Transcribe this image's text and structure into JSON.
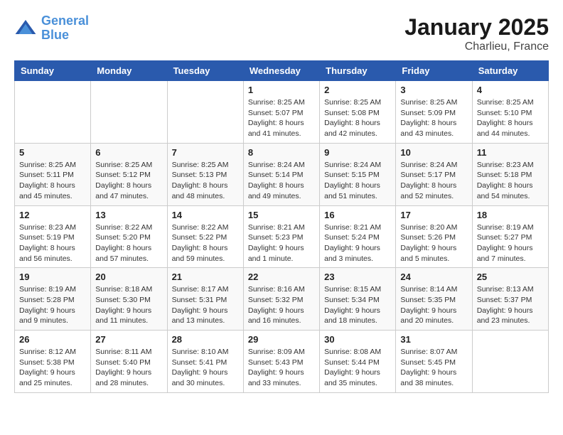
{
  "header": {
    "logo_line1": "General",
    "logo_line2": "Blue",
    "month": "January 2025",
    "location": "Charlieu, France"
  },
  "weekdays": [
    "Sunday",
    "Monday",
    "Tuesday",
    "Wednesday",
    "Thursday",
    "Friday",
    "Saturday"
  ],
  "weeks": [
    [
      {
        "day": "",
        "sunrise": "",
        "sunset": "",
        "daylight": ""
      },
      {
        "day": "",
        "sunrise": "",
        "sunset": "",
        "daylight": ""
      },
      {
        "day": "",
        "sunrise": "",
        "sunset": "",
        "daylight": ""
      },
      {
        "day": "1",
        "sunrise": "Sunrise: 8:25 AM",
        "sunset": "Sunset: 5:07 PM",
        "daylight": "Daylight: 8 hours and 41 minutes."
      },
      {
        "day": "2",
        "sunrise": "Sunrise: 8:25 AM",
        "sunset": "Sunset: 5:08 PM",
        "daylight": "Daylight: 8 hours and 42 minutes."
      },
      {
        "day": "3",
        "sunrise": "Sunrise: 8:25 AM",
        "sunset": "Sunset: 5:09 PM",
        "daylight": "Daylight: 8 hours and 43 minutes."
      },
      {
        "day": "4",
        "sunrise": "Sunrise: 8:25 AM",
        "sunset": "Sunset: 5:10 PM",
        "daylight": "Daylight: 8 hours and 44 minutes."
      }
    ],
    [
      {
        "day": "5",
        "sunrise": "Sunrise: 8:25 AM",
        "sunset": "Sunset: 5:11 PM",
        "daylight": "Daylight: 8 hours and 45 minutes."
      },
      {
        "day": "6",
        "sunrise": "Sunrise: 8:25 AM",
        "sunset": "Sunset: 5:12 PM",
        "daylight": "Daylight: 8 hours and 47 minutes."
      },
      {
        "day": "7",
        "sunrise": "Sunrise: 8:25 AM",
        "sunset": "Sunset: 5:13 PM",
        "daylight": "Daylight: 8 hours and 48 minutes."
      },
      {
        "day": "8",
        "sunrise": "Sunrise: 8:24 AM",
        "sunset": "Sunset: 5:14 PM",
        "daylight": "Daylight: 8 hours and 49 minutes."
      },
      {
        "day": "9",
        "sunrise": "Sunrise: 8:24 AM",
        "sunset": "Sunset: 5:15 PM",
        "daylight": "Daylight: 8 hours and 51 minutes."
      },
      {
        "day": "10",
        "sunrise": "Sunrise: 8:24 AM",
        "sunset": "Sunset: 5:17 PM",
        "daylight": "Daylight: 8 hours and 52 minutes."
      },
      {
        "day": "11",
        "sunrise": "Sunrise: 8:23 AM",
        "sunset": "Sunset: 5:18 PM",
        "daylight": "Daylight: 8 hours and 54 minutes."
      }
    ],
    [
      {
        "day": "12",
        "sunrise": "Sunrise: 8:23 AM",
        "sunset": "Sunset: 5:19 PM",
        "daylight": "Daylight: 8 hours and 56 minutes."
      },
      {
        "day": "13",
        "sunrise": "Sunrise: 8:22 AM",
        "sunset": "Sunset: 5:20 PM",
        "daylight": "Daylight: 8 hours and 57 minutes."
      },
      {
        "day": "14",
        "sunrise": "Sunrise: 8:22 AM",
        "sunset": "Sunset: 5:22 PM",
        "daylight": "Daylight: 8 hours and 59 minutes."
      },
      {
        "day": "15",
        "sunrise": "Sunrise: 8:21 AM",
        "sunset": "Sunset: 5:23 PM",
        "daylight": "Daylight: 9 hours and 1 minute."
      },
      {
        "day": "16",
        "sunrise": "Sunrise: 8:21 AM",
        "sunset": "Sunset: 5:24 PM",
        "daylight": "Daylight: 9 hours and 3 minutes."
      },
      {
        "day": "17",
        "sunrise": "Sunrise: 8:20 AM",
        "sunset": "Sunset: 5:26 PM",
        "daylight": "Daylight: 9 hours and 5 minutes."
      },
      {
        "day": "18",
        "sunrise": "Sunrise: 8:19 AM",
        "sunset": "Sunset: 5:27 PM",
        "daylight": "Daylight: 9 hours and 7 minutes."
      }
    ],
    [
      {
        "day": "19",
        "sunrise": "Sunrise: 8:19 AM",
        "sunset": "Sunset: 5:28 PM",
        "daylight": "Daylight: 9 hours and 9 minutes."
      },
      {
        "day": "20",
        "sunrise": "Sunrise: 8:18 AM",
        "sunset": "Sunset: 5:30 PM",
        "daylight": "Daylight: 9 hours and 11 minutes."
      },
      {
        "day": "21",
        "sunrise": "Sunrise: 8:17 AM",
        "sunset": "Sunset: 5:31 PM",
        "daylight": "Daylight: 9 hours and 13 minutes."
      },
      {
        "day": "22",
        "sunrise": "Sunrise: 8:16 AM",
        "sunset": "Sunset: 5:32 PM",
        "daylight": "Daylight: 9 hours and 16 minutes."
      },
      {
        "day": "23",
        "sunrise": "Sunrise: 8:15 AM",
        "sunset": "Sunset: 5:34 PM",
        "daylight": "Daylight: 9 hours and 18 minutes."
      },
      {
        "day": "24",
        "sunrise": "Sunrise: 8:14 AM",
        "sunset": "Sunset: 5:35 PM",
        "daylight": "Daylight: 9 hours and 20 minutes."
      },
      {
        "day": "25",
        "sunrise": "Sunrise: 8:13 AM",
        "sunset": "Sunset: 5:37 PM",
        "daylight": "Daylight: 9 hours and 23 minutes."
      }
    ],
    [
      {
        "day": "26",
        "sunrise": "Sunrise: 8:12 AM",
        "sunset": "Sunset: 5:38 PM",
        "daylight": "Daylight: 9 hours and 25 minutes."
      },
      {
        "day": "27",
        "sunrise": "Sunrise: 8:11 AM",
        "sunset": "Sunset: 5:40 PM",
        "daylight": "Daylight: 9 hours and 28 minutes."
      },
      {
        "day": "28",
        "sunrise": "Sunrise: 8:10 AM",
        "sunset": "Sunset: 5:41 PM",
        "daylight": "Daylight: 9 hours and 30 minutes."
      },
      {
        "day": "29",
        "sunrise": "Sunrise: 8:09 AM",
        "sunset": "Sunset: 5:43 PM",
        "daylight": "Daylight: 9 hours and 33 minutes."
      },
      {
        "day": "30",
        "sunrise": "Sunrise: 8:08 AM",
        "sunset": "Sunset: 5:44 PM",
        "daylight": "Daylight: 9 hours and 35 minutes."
      },
      {
        "day": "31",
        "sunrise": "Sunrise: 8:07 AM",
        "sunset": "Sunset: 5:45 PM",
        "daylight": "Daylight: 9 hours and 38 minutes."
      },
      {
        "day": "",
        "sunrise": "",
        "sunset": "",
        "daylight": ""
      }
    ]
  ]
}
